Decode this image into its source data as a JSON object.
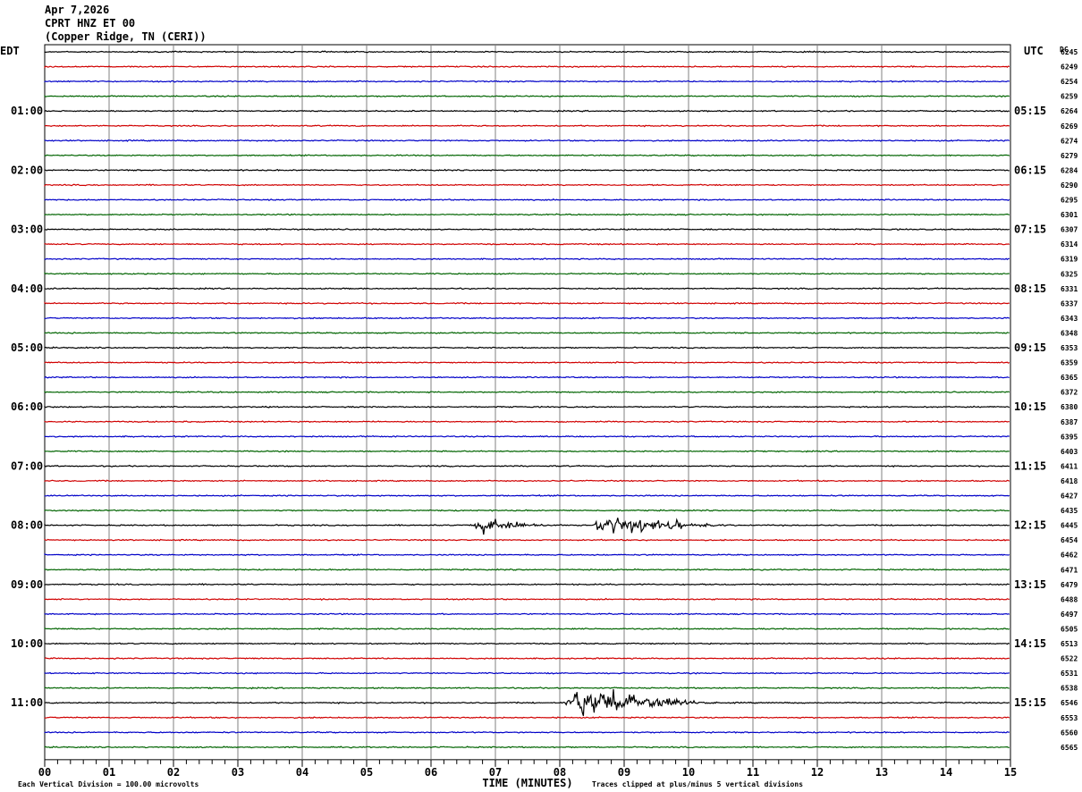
{
  "header": {
    "date": "Apr 7,2026",
    "station": "CPRT HNZ ET 00",
    "location": "(Copper Ridge, TN (CERI))"
  },
  "chart_data": {
    "type": "line",
    "description_free": true,
    "left_timezone": "EDT",
    "right_timezone": "UTC",
    "right_header": "DC",
    "x_range": [
      0,
      15
    ],
    "xlabel": "TIME (MINUTES)",
    "x_ticks": [
      "00",
      "01",
      "02",
      "03",
      "04",
      "05",
      "06",
      "07",
      "08",
      "09",
      "10",
      "11",
      "12",
      "13",
      "14",
      "15"
    ],
    "trace_colors": [
      "#000000",
      "#d00000",
      "#0000c8",
      "#006400"
    ],
    "left_hour_labels": [
      "01:00",
      "02:00",
      "03:00",
      "04:00",
      "05:00",
      "06:00",
      "07:00",
      "08:00",
      "09:00",
      "10:00",
      "11:00"
    ],
    "right_hour_labels": [
      "05:15",
      "06:15",
      "07:15",
      "08:15",
      "09:15",
      "10:15",
      "11:15",
      "12:15",
      "13:15",
      "14:15",
      "15:15"
    ],
    "dc_offsets": [
      "6245",
      "6249",
      "6254",
      "6259",
      "6264",
      "6269",
      "6274",
      "6279",
      "6284",
      "6290",
      "6295",
      "6301",
      "6307",
      "6314",
      "6319",
      "6325",
      "6331",
      "6337",
      "6343",
      "6348",
      "6353",
      "6359",
      "6365",
      "6372",
      "6380",
      "6387",
      "6395",
      "6403",
      "6411",
      "6418",
      "6427",
      "6435",
      "6445",
      "6454",
      "6462",
      "6471",
      "6479",
      "6488",
      "6497",
      "6505",
      "6513",
      "6522",
      "6531",
      "6538",
      "6546",
      "6553",
      "6560",
      "6565"
    ],
    "events": [
      {
        "trace": 32,
        "start_min": 6.6,
        "end_min": 8.0,
        "amplitude_divisions": 1.2
      },
      {
        "trace": 32,
        "start_min": 8.5,
        "end_min": 10.7,
        "amplitude_divisions": 2.0
      },
      {
        "trace": 44,
        "start_min": 8.05,
        "end_min": 10.5,
        "amplitude_divisions": 3.0
      }
    ],
    "footer_left": "Each Vertical Division =  100.00 microvolts",
    "footer_right": "Traces clipped at plus/minus 5 vertical divisions"
  }
}
